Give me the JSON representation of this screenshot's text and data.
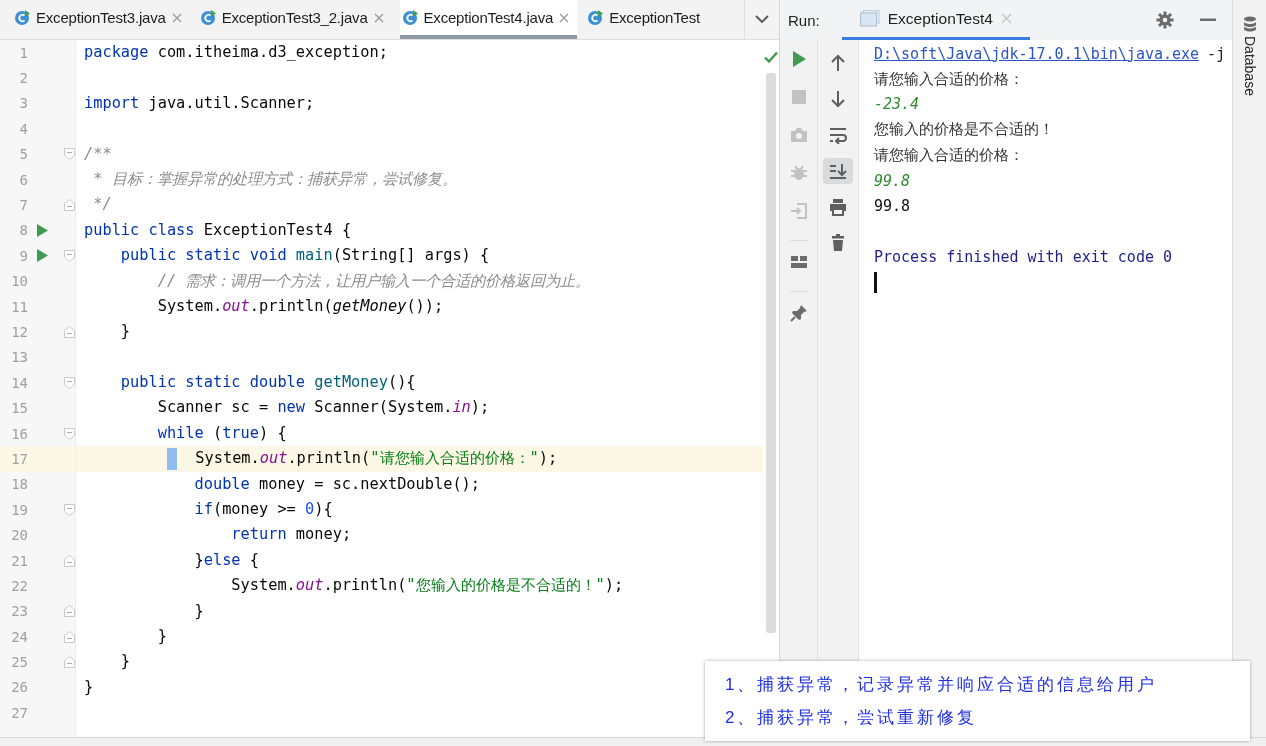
{
  "editor_tabs": [
    {
      "label": "ExceptionTest3.java",
      "selected": false,
      "closable": true
    },
    {
      "label": "ExceptionTest3_2.java",
      "selected": false,
      "closable": true
    },
    {
      "label": "ExceptionTest4.java",
      "selected": true,
      "closable": true
    },
    {
      "label": "ExceptionTest",
      "selected": false,
      "closable": false
    }
  ],
  "code_lines": [
    {
      "number": "1",
      "run": false,
      "current": false,
      "fold_start": false,
      "fold_end": false,
      "tokens": [
        {
          "kind": "kw",
          "text": "package "
        },
        {
          "kind": "plain",
          "text": "com.itheima.d3_exception;"
        }
      ]
    },
    {
      "number": "2",
      "run": false,
      "current": false,
      "fold_start": false,
      "fold_end": false
    },
    {
      "number": "3",
      "run": false,
      "current": false,
      "fold_start": false,
      "fold_end": false,
      "tokens": [
        {
          "kind": "kw",
          "text": "import "
        },
        {
          "kind": "plain",
          "text": "java.util.Scanner;"
        }
      ]
    },
    {
      "number": "4",
      "run": false,
      "current": false,
      "fold_start": false,
      "fold_end": false
    },
    {
      "number": "5",
      "run": false,
      "current": false,
      "fold_start": true,
      "fold_end": false,
      "tokens": [
        {
          "kind": "comment",
          "text": "/**"
        }
      ]
    },
    {
      "number": "6",
      "run": false,
      "current": false,
      "fold_start": false,
      "fold_end": false,
      "tokens": [
        {
          "kind": "comment",
          "text": " * 目标：掌握异常的处理方式：捕获异常，尝试修复。"
        }
      ]
    },
    {
      "number": "7",
      "run": false,
      "current": false,
      "fold_start": false,
      "fold_end": true,
      "tokens": [
        {
          "kind": "comment",
          "text": " */"
        }
      ]
    },
    {
      "number": "8",
      "run": true,
      "current": false,
      "fold_start": false,
      "fold_end": false,
      "tokens": [
        {
          "kind": "kw",
          "text": "public class "
        },
        {
          "kind": "plain",
          "text": "ExceptionTest4 {"
        }
      ]
    },
    {
      "number": "9",
      "run": true,
      "current": false,
      "fold_start": true,
      "fold_end": false,
      "tokens": [
        {
          "kind": "kw",
          "text": "    public static void "
        },
        {
          "kind": "decl",
          "text": "main"
        },
        {
          "kind": "plain",
          "text": "(String[] args) {"
        }
      ]
    },
    {
      "number": "10",
      "run": false,
      "current": false,
      "fold_start": false,
      "fold_end": false,
      "tokens": [
        {
          "kind": "comment",
          "text": "        // 需求：调用一个方法，让用户输入一个合适的价格返回为止。"
        }
      ]
    },
    {
      "number": "11",
      "run": false,
      "current": false,
      "fold_start": false,
      "fold_end": false,
      "tokens": [
        {
          "kind": "plain",
          "text": "        System."
        },
        {
          "kind": "field",
          "text": "out"
        },
        {
          "kind": "plain",
          "text": ".println("
        },
        {
          "kind": "call",
          "text": "getMoney"
        },
        {
          "kind": "plain",
          "text": "());"
        }
      ]
    },
    {
      "number": "12",
      "run": false,
      "current": false,
      "fold_start": false,
      "fold_end": true,
      "tokens": [
        {
          "kind": "plain",
          "text": "    }"
        }
      ]
    },
    {
      "number": "13",
      "run": false,
      "current": false,
      "fold_start": false,
      "fold_end": false
    },
    {
      "number": "14",
      "run": false,
      "current": false,
      "fold_start": true,
      "fold_end": false,
      "tokens": [
        {
          "kind": "kw",
          "text": "    public static double "
        },
        {
          "kind": "decl",
          "text": "getMoney"
        },
        {
          "kind": "plain",
          "text": "(){"
        }
      ]
    },
    {
      "number": "15",
      "run": false,
      "current": false,
      "fold_start": false,
      "fold_end": false,
      "tokens": [
        {
          "kind": "plain",
          "text": "        Scanner sc = "
        },
        {
          "kind": "kw",
          "text": "new "
        },
        {
          "kind": "plain",
          "text": "Scanner(System."
        },
        {
          "kind": "field",
          "text": "in"
        },
        {
          "kind": "plain",
          "text": ");"
        }
      ]
    },
    {
      "number": "16",
      "run": false,
      "current": false,
      "fold_start": true,
      "fold_end": false,
      "tokens": [
        {
          "kind": "kw",
          "text": "        while "
        },
        {
          "kind": "plain",
          "text": "("
        },
        {
          "kind": "kw",
          "text": "true"
        },
        {
          "kind": "plain",
          "text": ") {"
        }
      ]
    },
    {
      "number": "17",
      "run": false,
      "current": true,
      "fold_start": false,
      "fold_end": false,
      "tokens": [
        {
          "kind": "marker"
        },
        {
          "kind": "plain",
          "text": "  System."
        },
        {
          "kind": "field",
          "text": "out"
        },
        {
          "kind": "plain",
          "text": ".println("
        },
        {
          "kind": "str",
          "text": "\"请您输入合适的价格：\""
        },
        {
          "kind": "plain",
          "text": ");"
        }
      ]
    },
    {
      "number": "18",
      "run": false,
      "current": false,
      "fold_start": false,
      "fold_end": false,
      "tokens": [
        {
          "kind": "kw",
          "text": "            double "
        },
        {
          "kind": "plain",
          "text": "money = sc.nextDouble();"
        }
      ]
    },
    {
      "number": "19",
      "run": false,
      "current": false,
      "fold_start": true,
      "fold_end": false,
      "tokens": [
        {
          "kind": "kw",
          "text": "            if"
        },
        {
          "kind": "plain",
          "text": "(money >= "
        },
        {
          "kind": "num",
          "text": "0"
        },
        {
          "kind": "plain",
          "text": "){"
        }
      ]
    },
    {
      "number": "20",
      "run": false,
      "current": false,
      "fold_start": false,
      "fold_end": false,
      "tokens": [
        {
          "kind": "kw",
          "text": "                return "
        },
        {
          "kind": "plain",
          "text": "money;"
        }
      ]
    },
    {
      "number": "21",
      "run": false,
      "current": false,
      "fold_start": false,
      "fold_end": true,
      "tokens": [
        {
          "kind": "plain",
          "text": "            }"
        },
        {
          "kind": "kw",
          "text": "else "
        },
        {
          "kind": "plain",
          "text": "{"
        }
      ]
    },
    {
      "number": "22",
      "run": false,
      "current": false,
      "fold_start": false,
      "fold_end": false,
      "tokens": [
        {
          "kind": "plain",
          "text": "                System."
        },
        {
          "kind": "field",
          "text": "out"
        },
        {
          "kind": "plain",
          "text": ".println("
        },
        {
          "kind": "str",
          "text": "\"您输入的价格是不合适的！\""
        },
        {
          "kind": "plain",
          "text": ");"
        }
      ]
    },
    {
      "number": "23",
      "run": false,
      "current": false,
      "fold_start": false,
      "fold_end": true,
      "tokens": [
        {
          "kind": "plain",
          "text": "            }"
        }
      ]
    },
    {
      "number": "24",
      "run": false,
      "current": false,
      "fold_start": false,
      "fold_end": true,
      "tokens": [
        {
          "kind": "plain",
          "text": "        }"
        }
      ]
    },
    {
      "number": "25",
      "run": false,
      "current": false,
      "fold_start": false,
      "fold_end": true,
      "tokens": [
        {
          "kind": "plain",
          "text": "    }"
        }
      ]
    },
    {
      "number": "26",
      "run": false,
      "current": false,
      "fold_start": false,
      "fold_end": false,
      "tokens": [
        {
          "kind": "plain",
          "text": "}"
        }
      ]
    },
    {
      "number": "27",
      "run": false,
      "current": false,
      "fold_start": false,
      "fold_end": false
    }
  ],
  "run_panel": {
    "label": "Run:",
    "tabs": [
      {
        "label": "ExceptionTest4",
        "selected": true
      }
    ],
    "left_toolbar": [
      {
        "kind": "run",
        "disabled": false
      },
      {
        "kind": "stop",
        "disabled": true
      },
      {
        "kind": "camera",
        "disabled": true
      },
      {
        "kind": "bug",
        "disabled": true
      },
      {
        "kind": "exit",
        "disabled": true
      },
      {
        "kind": "layout",
        "disabled": false
      },
      {
        "kind": "pin",
        "disabled": false
      }
    ],
    "right_toolbar": [
      {
        "kind": "up",
        "on": false
      },
      {
        "kind": "down",
        "on": false
      },
      {
        "kind": "wrap",
        "on": false
      },
      {
        "kind": "scroll-end",
        "on": true
      },
      {
        "kind": "print",
        "on": false
      },
      {
        "kind": "trash",
        "on": false
      }
    ],
    "output": [
      {
        "kind": "link",
        "text": "D:\\soft\\Java\\jdk-17.0.1\\bin\\java.exe"
      },
      {
        "kind": "plain",
        "text": "请您输入合适的价格："
      },
      {
        "kind": "input",
        "text": "-23.4"
      },
      {
        "kind": "plain",
        "text": "您输入的价格是不合适的！"
      },
      {
        "kind": "plain",
        "text": "请您输入合适的价格："
      },
      {
        "kind": "input",
        "text": "99.8"
      },
      {
        "kind": "value",
        "text": "99.8"
      },
      {
        "kind": "blank"
      },
      {
        "kind": "exit",
        "text": "Process finished with exit code 0"
      },
      {
        "kind": "cursor"
      }
    ],
    "link_tail": "-j"
  },
  "right_stripe": {
    "label": "Database"
  },
  "annotation": [
    "1、捕获异常，记录异常并响应合适的信息给用户",
    "2、捕获异常，尝试重新修复"
  ]
}
